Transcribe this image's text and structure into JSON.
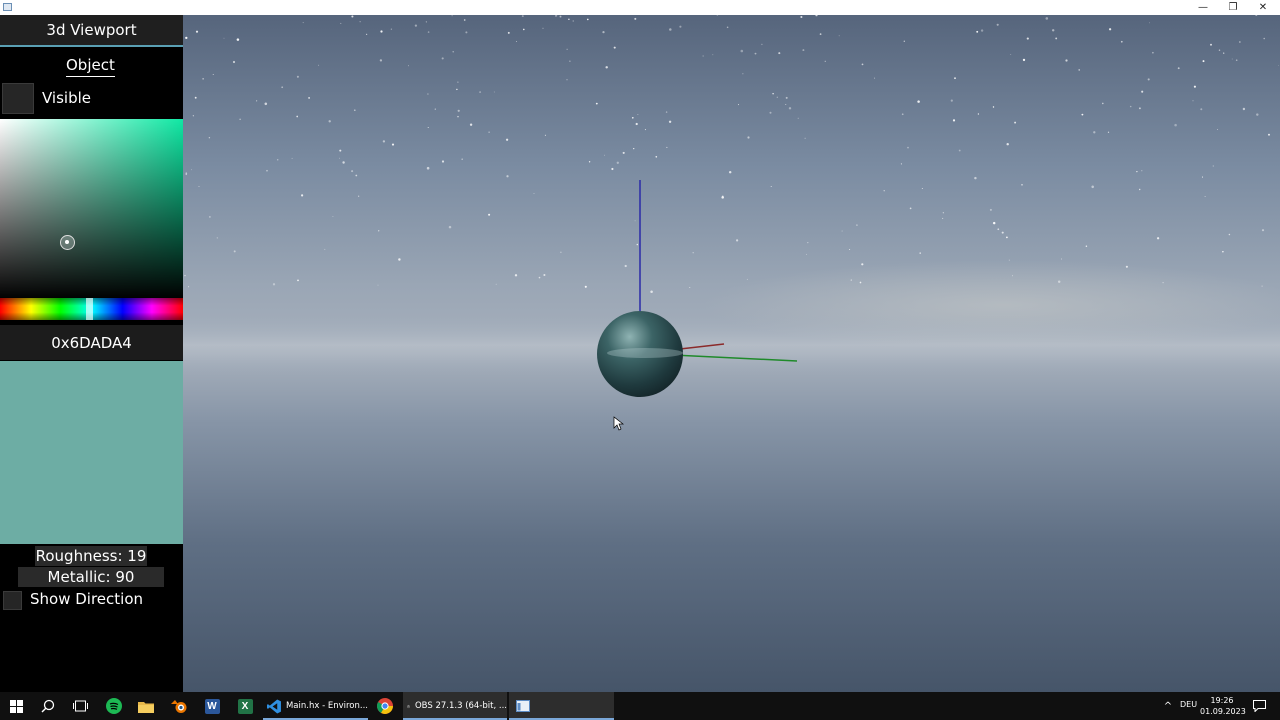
{
  "window": {
    "minimize_glyph": "—",
    "restore_glyph": "❐",
    "close_glyph": "✕"
  },
  "panel": {
    "title": "3d Viewport",
    "tab": "Object",
    "visible_label": "Visible",
    "visible_checked": false,
    "color_hex": "0x6DADA4",
    "swatch_color": "#6dada4",
    "picker_hue_color": "#10e8a4",
    "roughness_label": "Roughness: 19",
    "metallic_label": "Metallic: 90",
    "show_direction_label": "Show Direction",
    "show_direction_checked": false
  },
  "viewport": {
    "object": "sphere",
    "axis_colors": {
      "x": "#8b2a2a",
      "y": "#1f8a2a",
      "z": "#2a2aa8"
    }
  },
  "taskbar": {
    "apps": [
      {
        "name": "start-icon"
      },
      {
        "name": "search-icon"
      },
      {
        "name": "task-view-icon"
      },
      {
        "name": "spotify-icon"
      },
      {
        "name": "file-explorer-icon"
      },
      {
        "name": "blender-icon"
      },
      {
        "name": "word-icon",
        "glyph": "W"
      },
      {
        "name": "excel-icon",
        "glyph": "X"
      }
    ],
    "tasks": [
      {
        "name": "vscode-task",
        "label": "Main.hx - Environ..."
      },
      {
        "name": "chrome-task",
        "label": ""
      },
      {
        "name": "obs-task",
        "label": "OBS 27.1.3 (64-bit, ..."
      },
      {
        "name": "app-window-task",
        "label": ""
      }
    ],
    "tray_chevron": "^",
    "language": "DEU",
    "time": "19:26",
    "date": "01.09.2023"
  }
}
